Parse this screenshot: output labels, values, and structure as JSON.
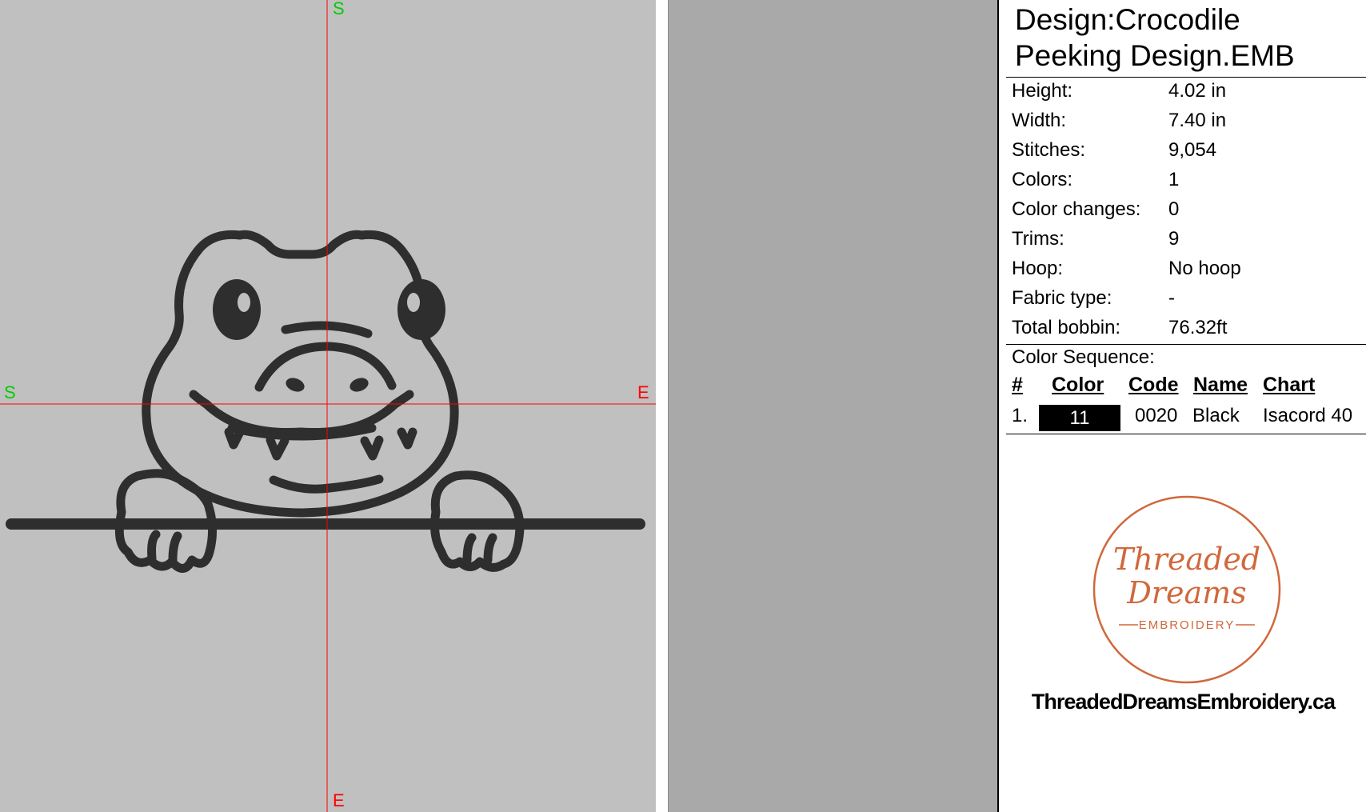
{
  "axes": {
    "top": "S",
    "left": "S",
    "right": "E",
    "bottom": "E"
  },
  "info": {
    "title_line1": "Design:Crocodile",
    "title_line2": "Peeking Design.EMB",
    "rows": [
      {
        "label": "Height:",
        "value": "4.02 in"
      },
      {
        "label": "Width:",
        "value": "7.40 in"
      },
      {
        "label": "Stitches:",
        "value": "9,054"
      },
      {
        "label": "Colors:",
        "value": "1"
      },
      {
        "label": "Color changes:",
        "value": "0"
      },
      {
        "label": "Trims:",
        "value": "9"
      },
      {
        "label": "Hoop:",
        "value": "No hoop"
      },
      {
        "label": "Fabric type:",
        "value": "-"
      },
      {
        "label": "Total bobbin:",
        "value": "76.32ft"
      }
    ],
    "color_sequence": {
      "title": "Color Sequence:",
      "headers": {
        "num": "#",
        "color": "Color",
        "code": "Code",
        "name": "Name",
        "chart": "Chart"
      },
      "items": [
        {
          "num": "1.",
          "color_label": "11",
          "swatch": "#000000",
          "code": "0020",
          "name": "Black",
          "chart": "Isacord 40"
        }
      ]
    }
  },
  "logo": {
    "line1": "Threaded",
    "line2": "Dreams",
    "line3": "EMBROIDERY",
    "website": "ThreadedDreamsEmbroidery.ca",
    "color": "#d0683c"
  },
  "colors": {
    "canvas_bg": "#c0c0c0",
    "crosshair": "#ff0000",
    "axis_s": "#00cc00",
    "axis_e": "#ff0000",
    "stitch": "#2e2e2e"
  }
}
